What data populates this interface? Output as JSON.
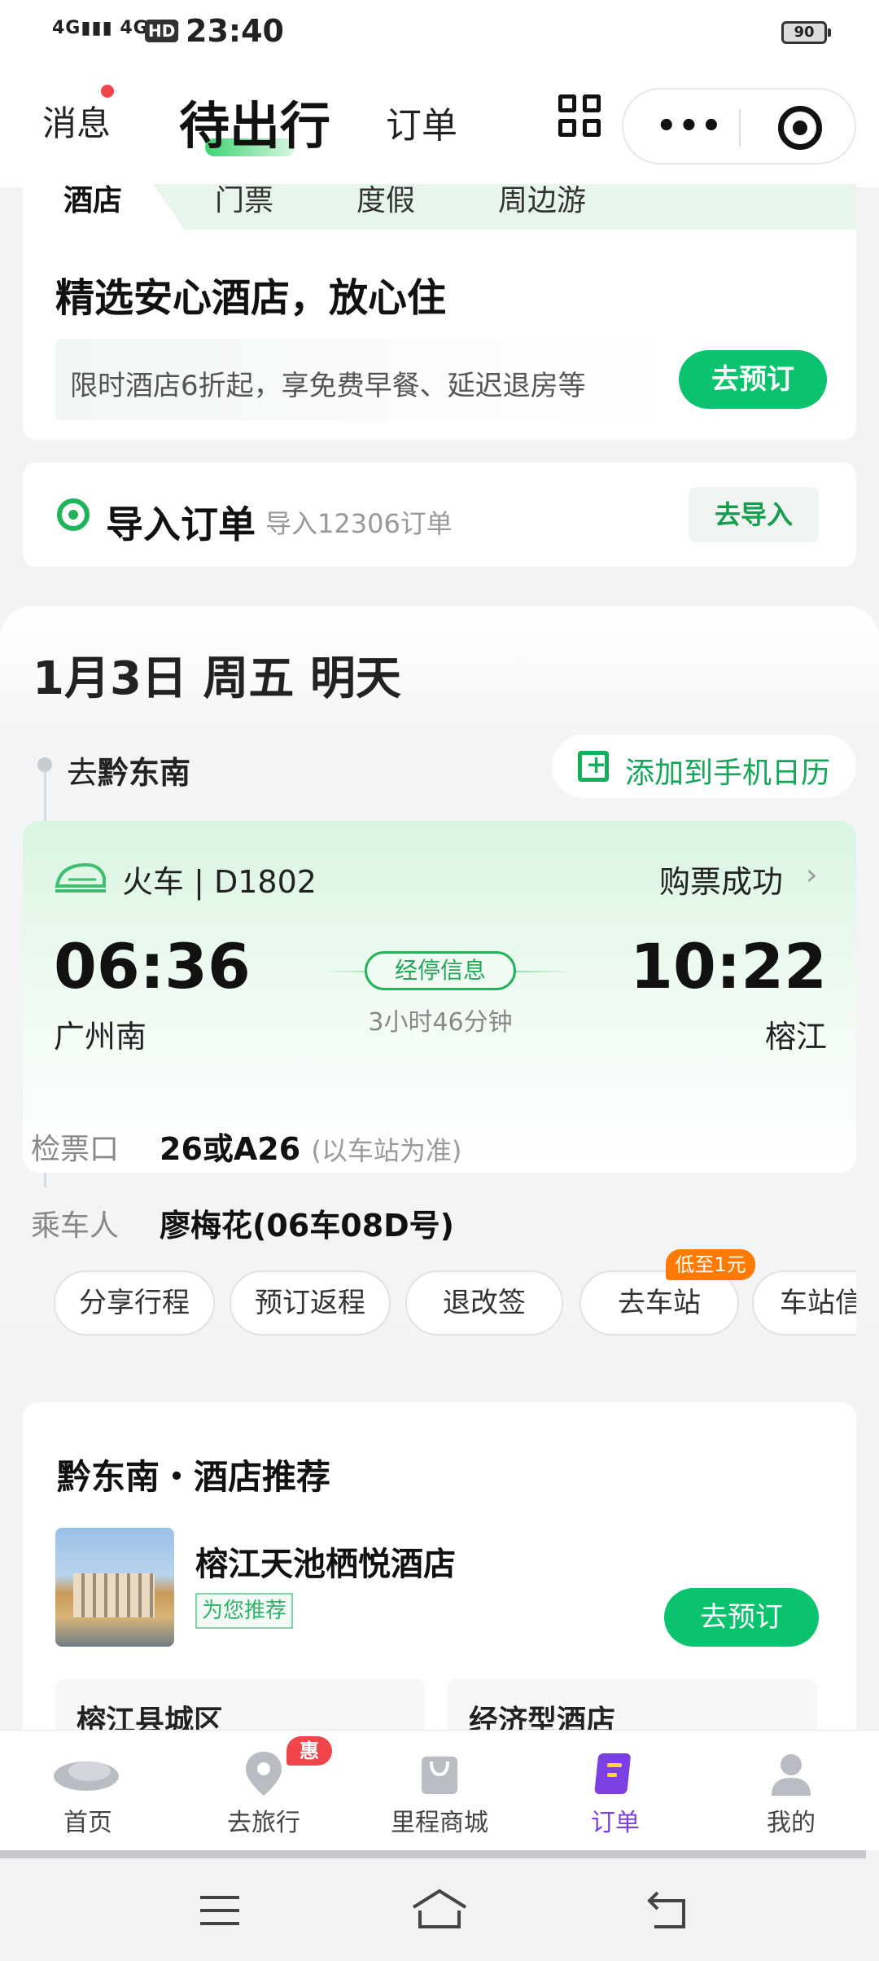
{
  "status_bar": {
    "signal_1": "4G",
    "signal_2": "4G",
    "hd": "HD",
    "time": "23:40",
    "battery": "90"
  },
  "header": {
    "messages": "消息",
    "active_tab": "待出行",
    "orders_tab": "订单",
    "capsule_more": "•••"
  },
  "hotel_card": {
    "tabs": [
      "酒店",
      "门票",
      "度假",
      "周边游"
    ],
    "title": "精选安心酒店，放心住",
    "promo": "限时酒店6折起，享免费早餐、延迟退房等",
    "button": "去预订"
  },
  "import_card": {
    "title": "导入订单",
    "subtitle": "导入12306订单",
    "button": "去导入"
  },
  "trip": {
    "date": "1月3日 周五 明天",
    "destination_prefix": "去",
    "destination": "黔东南",
    "add_calendar": "添加到手机日历",
    "train": {
      "label": "火车 | D1802",
      "status": "购票成功",
      "depart_time": "06:36",
      "arrive_time": "10:22",
      "depart_station": "广州南",
      "arrive_station": "榕江",
      "stops_button": "经停信息",
      "duration": "3小时46分钟",
      "gate_label": "检票口",
      "gate_value": "26或A26",
      "gate_note": "(以车站为准)",
      "passenger_label": "乘车人",
      "passenger_value": "廖梅花(06车08D号)"
    },
    "actions": [
      "分享行程",
      "预订返程",
      "退改签",
      "去车站",
      "车站信息"
    ],
    "station_badge": "低至1元"
  },
  "recommend": {
    "title": "黔东南・酒店推荐",
    "hotel_name": "榕江天池栖悦酒店",
    "tag": "为您推荐",
    "button": "去预订",
    "sub_left": "榕江县城区",
    "sub_right": "经济型酒店"
  },
  "bottom_nav": {
    "items": [
      {
        "label": "首页",
        "icon": "whale-icon"
      },
      {
        "label": "去旅行",
        "icon": "location-pin-icon"
      },
      {
        "label": "里程商城",
        "icon": "shopping-bag-icon"
      },
      {
        "label": "订单",
        "icon": "order-note-icon"
      },
      {
        "label": "我的",
        "icon": "person-icon"
      }
    ],
    "badge": "惠",
    "active_color": "#7b3fe4"
  },
  "colors": {
    "brand_green": "#0bc36e",
    "accent_red": "#f0464b",
    "badge_orange": "#ff7a00"
  }
}
